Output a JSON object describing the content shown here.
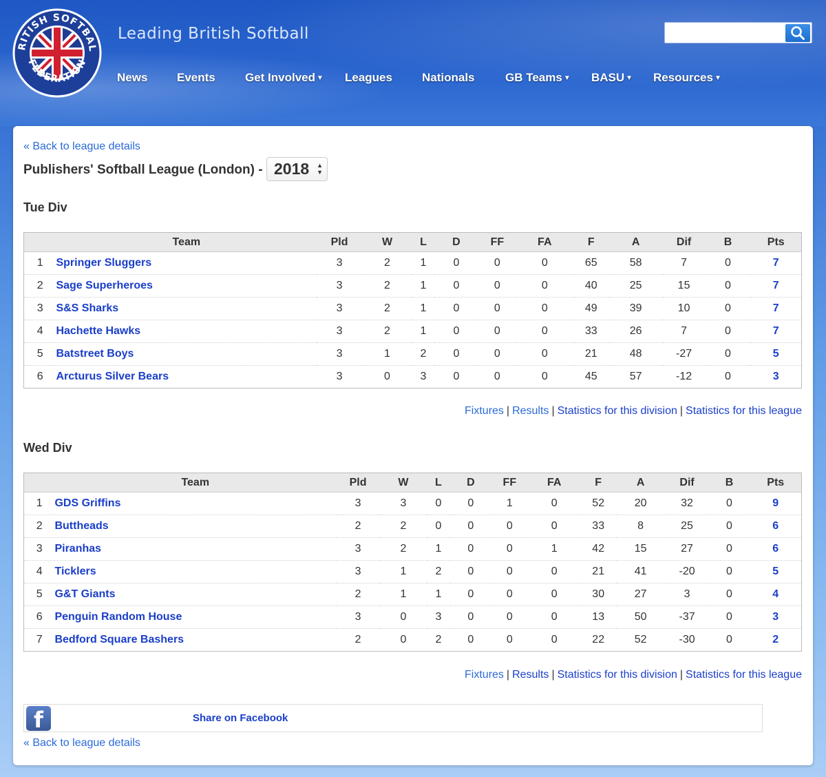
{
  "header": {
    "tagline": "Leading British Softball",
    "logo_text_top": "BRITISH SOFTBALL",
    "logo_text_bottom": "FEDERATION",
    "search_placeholder": ""
  },
  "nav": [
    {
      "label": "News",
      "dropdown": false
    },
    {
      "label": "Events",
      "dropdown": false
    },
    {
      "label": "Get Involved",
      "dropdown": true
    },
    {
      "label": "Leagues",
      "dropdown": false
    },
    {
      "label": "Nationals",
      "dropdown": false
    },
    {
      "label": "GB Teams",
      "dropdown": true
    },
    {
      "label": "BASU",
      "dropdown": true
    },
    {
      "label": "Resources",
      "dropdown": true
    }
  ],
  "page": {
    "back_link": "« Back to league details",
    "league_title": "Publishers' Softball League (London) -",
    "season": "2018",
    "share_label": "Share on Facebook"
  },
  "columns": [
    "",
    "Team",
    "Pld",
    "W",
    "L",
    "D",
    "FF",
    "FA",
    "F",
    "A",
    "Dif",
    "B",
    "Pts"
  ],
  "footer_links": [
    "Fixtures",
    "Results",
    "Statistics for this division",
    "Statistics for this league"
  ],
  "divisions": [
    {
      "name": "Tue Div",
      "rows": [
        [
          "1",
          "Springer Sluggers",
          "3",
          "2",
          "1",
          "0",
          "0",
          "0",
          "65",
          "58",
          "7",
          "0",
          "7"
        ],
        [
          "2",
          "Sage Superheroes",
          "3",
          "2",
          "1",
          "0",
          "0",
          "0",
          "40",
          "25",
          "15",
          "0",
          "7"
        ],
        [
          "3",
          "S&S Sharks",
          "3",
          "2",
          "1",
          "0",
          "0",
          "0",
          "49",
          "39",
          "10",
          "0",
          "7"
        ],
        [
          "4",
          "Hachette Hawks",
          "3",
          "2",
          "1",
          "0",
          "0",
          "0",
          "33",
          "26",
          "7",
          "0",
          "7"
        ],
        [
          "5",
          "Batstreet Boys",
          "3",
          "1",
          "2",
          "0",
          "0",
          "0",
          "21",
          "48",
          "-27",
          "0",
          "5"
        ],
        [
          "6",
          "Arcturus Silver Bears",
          "3",
          "0",
          "3",
          "0",
          "0",
          "0",
          "45",
          "57",
          "-12",
          "0",
          "3"
        ]
      ]
    },
    {
      "name": "Wed Div",
      "rows": [
        [
          "1",
          "GDS Griffins",
          "3",
          "3",
          "0",
          "0",
          "1",
          "0",
          "52",
          "20",
          "32",
          "0",
          "9"
        ],
        [
          "2",
          "Buttheads",
          "2",
          "2",
          "0",
          "0",
          "0",
          "0",
          "33",
          "8",
          "25",
          "0",
          "6"
        ],
        [
          "3",
          "Piranhas",
          "3",
          "2",
          "1",
          "0",
          "0",
          "1",
          "42",
          "15",
          "27",
          "0",
          "6"
        ],
        [
          "4",
          "Ticklers",
          "3",
          "1",
          "2",
          "0",
          "0",
          "0",
          "21",
          "41",
          "-20",
          "0",
          "5"
        ],
        [
          "5",
          "G&T Giants",
          "2",
          "1",
          "1",
          "0",
          "0",
          "0",
          "30",
          "27",
          "3",
          "0",
          "4"
        ],
        [
          "6",
          "Penguin Random House",
          "3",
          "0",
          "3",
          "0",
          "0",
          "0",
          "13",
          "50",
          "-37",
          "0",
          "3"
        ],
        [
          "7",
          "Bedford Square Bashers",
          "2",
          "0",
          "2",
          "0",
          "0",
          "0",
          "22",
          "52",
          "-30",
          "0",
          "2"
        ]
      ]
    }
  ]
}
